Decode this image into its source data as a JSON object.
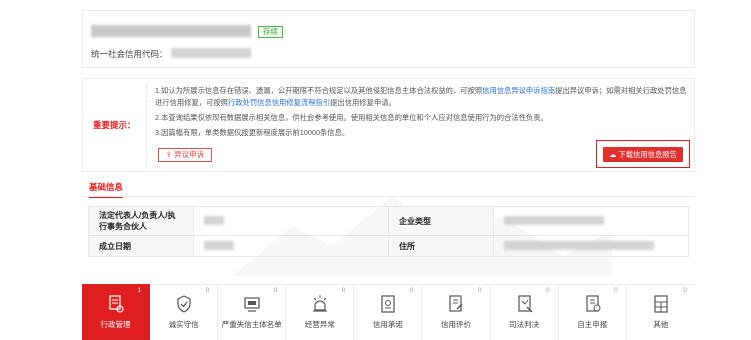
{
  "company": {
    "status": "存续",
    "credit_code_label": "统一社会信用代码："
  },
  "notice": {
    "title": "重要提示：",
    "line1_a": "1.如认为所展示信息存在错误、遗漏，公开期限不符合规定以及其他侵犯信息主体合法权益的，可按照",
    "line1_link1": "信用信息异议申诉指南",
    "line1_b": "提出异议申诉；如需对相关行政处罚信息进行信用修复，可按照",
    "line1_link2": "行政处罚信息信用修复流程指引",
    "line1_c": "提出信用修复申请。",
    "line2": "2.本查询结果仅依现有数据展示相关信息，供社会参考使用。使用相关信息的单位和个人应对信息使用行为的合法性负责。",
    "line3": "3.因篇幅有限，单类数据仅按更新程度展示前10000条信息。",
    "appeal_button": "异议申诉",
    "download_button": "下载信用信息报告"
  },
  "basic_info": {
    "tab_label": "基础信息",
    "legal_rep_label": "法定代表人/负责人/执行事务合伙人",
    "enterprise_type_label": "企业类型",
    "established_label": "成立日期",
    "address_label": "住所"
  },
  "bottom_tabs": [
    {
      "label": "行政管理",
      "count": "1",
      "icon": "document-stamp-icon"
    },
    {
      "label": "诚实守信",
      "count": "0",
      "icon": "shield-check-icon"
    },
    {
      "label": "严重失信主体名单",
      "count": "0",
      "icon": "blacklist-card-icon"
    },
    {
      "label": "经营异常",
      "count": "0",
      "icon": "alarm-light-icon"
    },
    {
      "label": "信用承诺",
      "count": "0",
      "icon": "commitment-document-icon"
    },
    {
      "label": "信用评价",
      "count": "0",
      "icon": "evaluation-document-icon"
    },
    {
      "label": "司法判决",
      "count": "0",
      "icon": "judgment-document-icon"
    },
    {
      "label": "自主申报",
      "count": "0",
      "icon": "self-declare-document-icon"
    },
    {
      "label": "其他",
      "count": "0",
      "icon": "grid-document-icon"
    }
  ],
  "colors": {
    "accent_red": "#e02020",
    "status_green": "#3ca63c",
    "link_blue": "#2a6fdb"
  }
}
